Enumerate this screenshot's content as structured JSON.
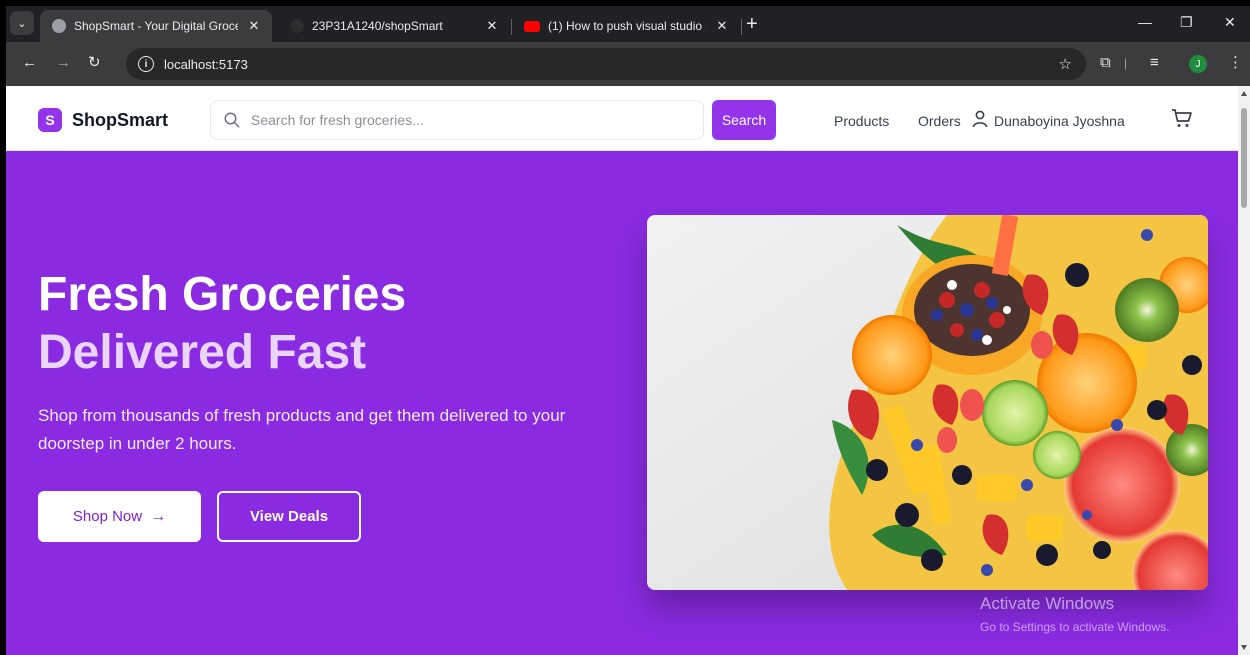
{
  "browser": {
    "tabs": [
      {
        "title": "ShopSmart - Your Digital Groce",
        "active": true
      },
      {
        "title": "23P31A1240/shopSmart",
        "active": false
      },
      {
        "title": "(1) How to push visual studio cc",
        "active": false
      }
    ],
    "address": "localhost:5173",
    "profile_initial": "J"
  },
  "navbar": {
    "logo_badge": "S",
    "logo_text": "ShopSmart",
    "search_placeholder": "Search for fresh groceries...",
    "search_button": "Search",
    "links": [
      "Products",
      "Orders"
    ],
    "user_name": "Dunaboyina Jyoshna"
  },
  "hero": {
    "title_line1": "Fresh Groceries",
    "title_line2": "Delivered Fast",
    "subtitle": "Shop from thousands of fresh products and get them delivered to your doorstep in under 2 hours.",
    "primary_button": "Shop Now",
    "secondary_button": "View Deals"
  },
  "watermark": {
    "title": "Activate Windows",
    "subtitle": "Go to Settings to activate Windows."
  },
  "colors": {
    "brand": "#9333ea",
    "hero_background": "#8a2be2",
    "hero_title_accent": "#e9d5ff"
  }
}
